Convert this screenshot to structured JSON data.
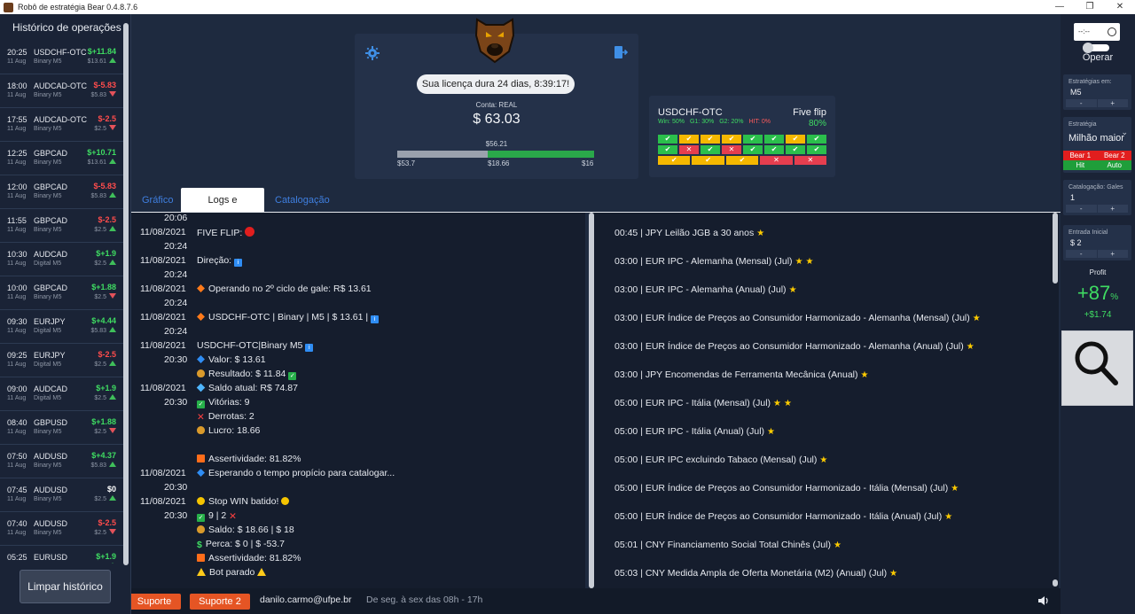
{
  "window": {
    "title": "Robô de estratégia Bear 0.4.8.7.6",
    "controls": [
      "—",
      "❐",
      "✕"
    ]
  },
  "sidebar": {
    "title": "Histórico de operações",
    "clear_label": "Limpar histórico",
    "trades": [
      {
        "time": "20:25",
        "date": "11 Aug",
        "pair": "USDCHF-OTC",
        "mode": "Binary M5",
        "result": "$+11.84",
        "stake": "$13.61",
        "dir": "up",
        "kind": "win"
      },
      {
        "time": "18:00",
        "date": "11 Aug",
        "pair": "AUDCAD-OTC",
        "mode": "Binary M5",
        "result": "$-5.83",
        "stake": "$5.83",
        "dir": "down",
        "kind": "loss"
      },
      {
        "time": "17:55",
        "date": "11 Aug",
        "pair": "AUDCAD-OTC",
        "mode": "Binary M5",
        "result": "$-2.5",
        "stake": "$2.5",
        "dir": "down",
        "kind": "loss"
      },
      {
        "time": "12:25",
        "date": "11 Aug",
        "pair": "GBPCAD",
        "mode": "Binary M5",
        "result": "$+10.71",
        "stake": "$13.61",
        "dir": "up",
        "kind": "win"
      },
      {
        "time": "12:00",
        "date": "11 Aug",
        "pair": "GBPCAD",
        "mode": "Binary M5",
        "result": "$-5.83",
        "stake": "$5.83",
        "dir": "up",
        "kind": "loss"
      },
      {
        "time": "11:55",
        "date": "11 Aug",
        "pair": "GBPCAD",
        "mode": "Binary M5",
        "result": "$-2.5",
        "stake": "$2.5",
        "dir": "up",
        "kind": "loss"
      },
      {
        "time": "10:30",
        "date": "11 Aug",
        "pair": "AUDCAD",
        "mode": "Digital M5",
        "result": "$+1.9",
        "stake": "$2.5",
        "dir": "up",
        "kind": "win"
      },
      {
        "time": "10:00",
        "date": "11 Aug",
        "pair": "GBPCAD",
        "mode": "Binary M5",
        "result": "$+1.88",
        "stake": "$2.5",
        "dir": "down",
        "kind": "win"
      },
      {
        "time": "09:30",
        "date": "11 Aug",
        "pair": "EURJPY",
        "mode": "Digital M5",
        "result": "$+4.44",
        "stake": "$5.83",
        "dir": "up",
        "kind": "win"
      },
      {
        "time": "09:25",
        "date": "11 Aug",
        "pair": "EURJPY",
        "mode": "Digital M5",
        "result": "$-2.5",
        "stake": "$2.5",
        "dir": "up",
        "kind": "loss"
      },
      {
        "time": "09:00",
        "date": "11 Aug",
        "pair": "AUDCAD",
        "mode": "Digital M5",
        "result": "$+1.9",
        "stake": "$2.5",
        "dir": "up",
        "kind": "win"
      },
      {
        "time": "08:40",
        "date": "11 Aug",
        "pair": "GBPUSD",
        "mode": "Binary M5",
        "result": "$+1.88",
        "stake": "$2.5",
        "dir": "down",
        "kind": "win"
      },
      {
        "time": "07:50",
        "date": "11 Aug",
        "pair": "AUDUSD",
        "mode": "Binary M5",
        "result": "$+4.37",
        "stake": "$5.83",
        "dir": "up",
        "kind": "win"
      },
      {
        "time": "07:45",
        "date": "11 Aug",
        "pair": "AUDUSD",
        "mode": "Binary M5",
        "result": "$0",
        "stake": "$2.5",
        "dir": "up",
        "kind": "neutral"
      },
      {
        "time": "07:40",
        "date": "11 Aug",
        "pair": "AUDUSD",
        "mode": "Binary M5",
        "result": "$-2.5",
        "stake": "$2.5",
        "dir": "down",
        "kind": "loss"
      },
      {
        "time": "05:25",
        "date": "11 Aug",
        "pair": "EURUSD",
        "mode": "Digital M5",
        "result": "$+1.9",
        "stake": "$2.5",
        "dir": "up",
        "kind": "win"
      }
    ]
  },
  "license": {
    "text": "Sua licença dura 24 dias, 8:39:17!",
    "account_label": "Conta: REAL",
    "balance": "$ 63.03",
    "bar_value": "$56.21",
    "bar_min": "$53.7",
    "bar_mid": "$18.66",
    "bar_max": "$16",
    "bar_gray_fraction": 0.46,
    "bar_green_fraction": 0.54
  },
  "strategy_card": {
    "pair": "USDCHF-OTC",
    "name": "Five flip",
    "stats": [
      {
        "text": "Win: 50%",
        "color": "#3fdc62"
      },
      {
        "text": "G1: 30%",
        "color": "#3fdc62"
      },
      {
        "text": "G2: 20%",
        "color": "#3fdc62"
      },
      {
        "text": "HIT: 0%",
        "color": "#ff5b5b"
      }
    ],
    "percent": "80%",
    "rows": [
      [
        "g",
        "y",
        "y",
        "y",
        "g",
        "g",
        "y",
        "g"
      ],
      [
        "g",
        "r",
        "g",
        "r",
        "g",
        "g",
        "g",
        "g"
      ]
    ],
    "summary": [
      "y",
      "y",
      "y",
      "r",
      "r"
    ]
  },
  "tabs": [
    "Gráfico",
    "Logs e notícias",
    "Catalogação"
  ],
  "logs": [
    {
      "date": "",
      "text": "20:06",
      "icon": ""
    },
    {
      "date": "11/08/2021",
      "text": "FIVE FLIP: ",
      "icon": "red-dot",
      "trail": true
    },
    {
      "date": "20:24",
      "text": "",
      "icon": ""
    },
    {
      "date": "11/08/2021",
      "text": "Direção: ",
      "icon": "info",
      "trail": true
    },
    {
      "date": "20:24",
      "text": "",
      "icon": ""
    },
    {
      "date": "11/08/2021",
      "text": "Operando no 2º ciclo de gale: R$ 13.61",
      "icon": "dia"
    },
    {
      "date": "20:24",
      "text": "",
      "icon": ""
    },
    {
      "date": "11/08/2021",
      "text": "USDCHF-OTC | Binary | M5 | $ 13.61 | ",
      "icon": "dia",
      "trailicon": "info"
    },
    {
      "date": "20:24",
      "text": "",
      "icon": ""
    },
    {
      "date": "11/08/2021",
      "text": "USDCHF-OTC|Binary M5 ",
      "icon": "",
      "trailicon": "info"
    },
    {
      "date": "20:30",
      "text": "Valor: $ 13.61",
      "icon": "dia-blue"
    },
    {
      "date": "",
      "text": "Resultado: $ 11.84 ",
      "icon": "bag",
      "trailicon": "check"
    },
    {
      "date": "11/08/2021",
      "text": "Saldo atual: R$ 74.87",
      "icon": "gem"
    },
    {
      "date": "20:30",
      "text": "Vitórias: 9",
      "icon": "check"
    },
    {
      "date": "",
      "text": "Derrotas: 2",
      "icon": "red-x"
    },
    {
      "date": "",
      "text": "Lucro: 18.66",
      "icon": "bag"
    },
    {
      "date": "",
      "text": "",
      "icon": ""
    },
    {
      "date": "",
      "text": "Assertividade: 81.82%",
      "icon": "sq-orange"
    },
    {
      "date": "11/08/2021",
      "text": "Esperando o tempo propício para catalogar...",
      "icon": "dia-blue"
    },
    {
      "date": "20:30",
      "text": "",
      "icon": ""
    },
    {
      "date": "11/08/2021",
      "text": "Stop WIN batido! ",
      "icon": "face",
      "trailicon": "face"
    },
    {
      "date": "20:30",
      "text": "9 | 2 ",
      "icon": "check",
      "trailicon": "red-x"
    },
    {
      "date": "",
      "text": "Saldo: $ 18.66 | $ 18",
      "icon": "bag"
    },
    {
      "date": "",
      "text": "Perca: $ 0 | $ -53.7",
      "icon": "dollar"
    },
    {
      "date": "",
      "text": "Assertividade: 81.82%",
      "icon": "sq-orange"
    },
    {
      "date": "",
      "text": "Bot parado ",
      "icon": "warn",
      "trailicon": "warn"
    }
  ],
  "news": [
    {
      "text": "00:45 | JPY Leilão JGB a 30 anos",
      "stars": 1
    },
    {
      "text": "03:00 | EUR IPC - Alemanha (Mensal) (Jul)",
      "stars": 2
    },
    {
      "text": "03:00 | EUR IPC - Alemanha (Anual) (Jul)",
      "stars": 1
    },
    {
      "text": "03:00 | EUR Índice de Preços ao Consumidor Harmonizado - Alemanha (Mensal) (Jul)",
      "stars": 1
    },
    {
      "text": "03:00 | EUR Índice de Preços ao Consumidor Harmonizado - Alemanha (Anual) (Jul)",
      "stars": 1
    },
    {
      "text": "03:00 | JPY Encomendas de Ferramenta Mecânica (Anual)",
      "stars": 1
    },
    {
      "text": "05:00 | EUR IPC - Itália (Mensal) (Jul)",
      "stars": 2
    },
    {
      "text": "05:00 | EUR IPC - Itália (Anual) (Jul)",
      "stars": 1
    },
    {
      "text": "05:00 | EUR IPC excluindo Tabaco (Mensal) (Jul)",
      "stars": 1
    },
    {
      "text": "05:00 | EUR Índice de Preços ao Consumidor Harmonizado - Itália (Mensal) (Jul)",
      "stars": 1
    },
    {
      "text": "05:00 | EUR Índice de Preços ao Consumidor Harmonizado - Itália (Anual) (Jul)",
      "stars": 1
    },
    {
      "text": "05:01 | CNY Financiamento Social Total Chinês (Jul)",
      "stars": 1
    },
    {
      "text": "05:03 | CNY Medida Ampla de Oferta Monetária (M2) (Anual) (Jul)",
      "stars": 1
    }
  ],
  "footer": {
    "support1": "Suporte",
    "support2": "Suporte 2",
    "email": "danilo.carmo@ufpe.br",
    "hours": "De seg. à sex das 08h - 17h"
  },
  "right_panel": {
    "time_placeholder": "--:--",
    "operar": "Operar",
    "strategies_label": "Estratégias em:",
    "strategies_value": "M5",
    "strategy_label": "Estratégia",
    "strategy_value": "Milhão maior",
    "bear1": "Bear 1",
    "bear2": "Bear 2",
    "hit": "Hit",
    "auto": "Auto",
    "gales_label": "Catalogação: Gales",
    "gales_value": "1",
    "entry_label": "Entrada Inicial",
    "entry_value": "$ 2",
    "profit_label": "Profit",
    "profit_pct": "+87",
    "profit_pct_unit": "%",
    "profit_money": "+$1.74",
    "minus": "-",
    "plus": "+"
  }
}
